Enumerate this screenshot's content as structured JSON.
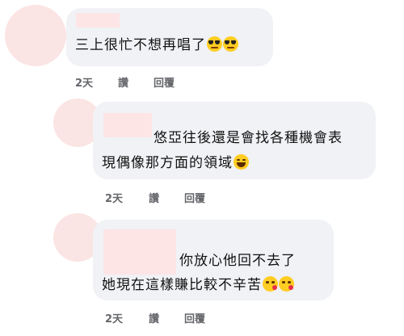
{
  "comments": [
    {
      "text_lines": [
        "三上很忙不想再唱了"
      ],
      "emoji": [
        "smiling-face-with-sunglasses",
        "smiling-face-with-sunglasses"
      ],
      "meta": {
        "time": "2天",
        "like": "讚",
        "reply": "回覆"
      }
    },
    {
      "text_lines": [
        "悠亞往後還是會找各種機會表",
        "現偶像那方面的領域"
      ],
      "emoji": [
        "face-with-tears-of-joy"
      ],
      "meta": {
        "time": "2天",
        "like": "讚",
        "reply": "回覆"
      }
    },
    {
      "text_lines": [
        "你放心他回不去了",
        "她現在這樣賺比較不辛苦"
      ],
      "emoji": [
        "face-blowing-a-kiss",
        "face-blowing-a-kiss"
      ],
      "meta": {
        "time": "2天",
        "like": "讚",
        "reply": "回覆"
      }
    }
  ],
  "colors": {
    "bubble": "#f0f2f5",
    "avatar_placeholder": "#fbe4e4",
    "name_placeholder": "#fde5e5",
    "meta_text": "#65676b"
  }
}
